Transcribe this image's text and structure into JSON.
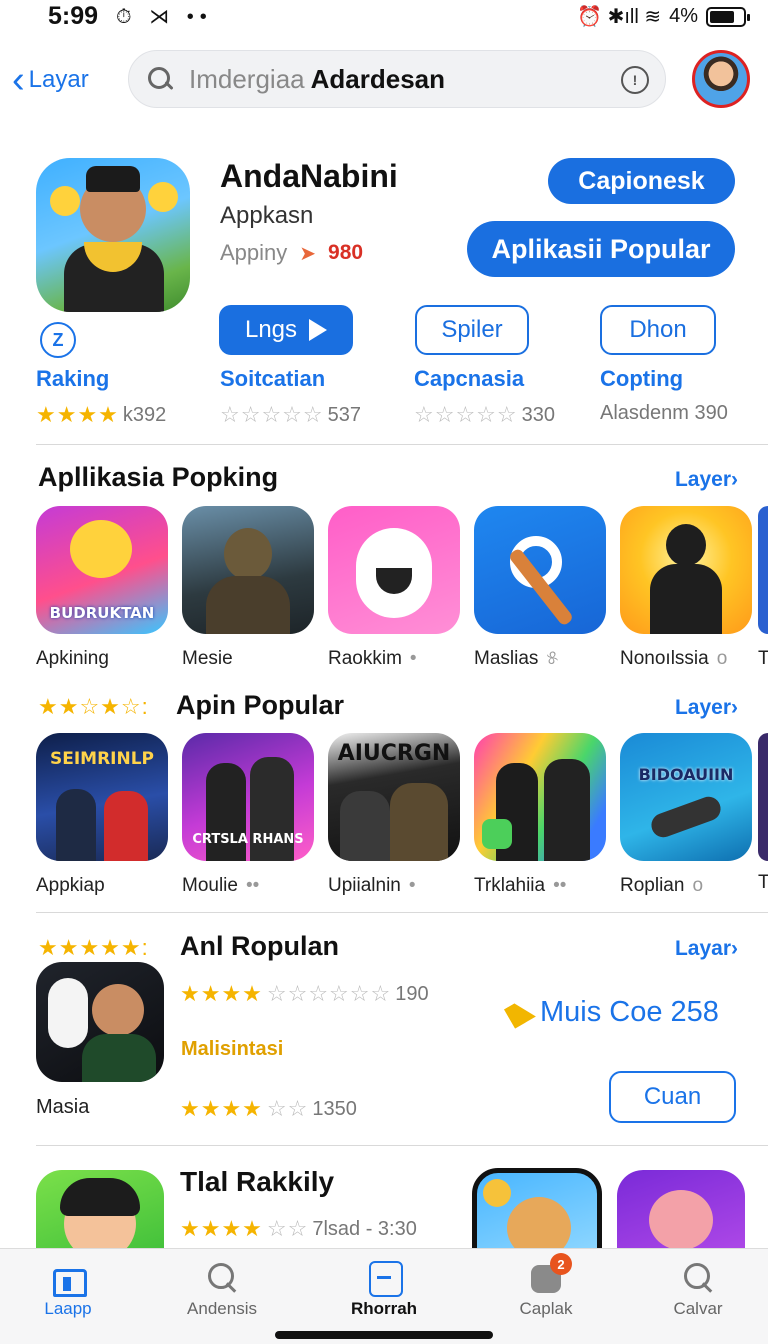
{
  "status": {
    "time": "5:99",
    "left_icons": "⏱ ⋊ ••",
    "right_icons": "⏰ ✱ıll ≋",
    "battery": "4%"
  },
  "header": {
    "back_label": "Layar",
    "search_placeholder": "Imdergiaa",
    "search_query": "Adardesan"
  },
  "featured": {
    "title": "AndaNabini",
    "subtitle": "Appkasn",
    "meta_label": "Appiny",
    "meta_value": "980",
    "button_primary": "Capionesk",
    "button_secondary": "Aplikasii Popular",
    "action_play": "Lngs",
    "action_two": "Spiler",
    "action_three": "Dhon",
    "stats": [
      {
        "label": "Raking",
        "rating": "k392"
      },
      {
        "label": "Soitcatian",
        "rating": "537"
      },
      {
        "label": "Capcnasia",
        "rating": "330"
      },
      {
        "label": "Copting",
        "rating": "Alasdenm 390"
      }
    ]
  },
  "section1": {
    "title": "Apllikasia Popking",
    "link": "Layer›",
    "apps": [
      {
        "name": "Apkining",
        "icon_text": "BUDRUKTAN"
      },
      {
        "name": "Mesie"
      },
      {
        "name": "Raokkim",
        "trail": "•"
      },
      {
        "name": "Maslias",
        "trail": "୫"
      },
      {
        "name": "Nonoılssia",
        "trail": "o"
      }
    ],
    "cut_label": "T"
  },
  "section2": {
    "title": "Apin Popular",
    "link": "Layer›",
    "apps": [
      {
        "name": "Appkiap",
        "icon_text": "SEIMRINLP"
      },
      {
        "name": "Moulie",
        "trail": "••",
        "icon_text": "CRTSLA RHANS"
      },
      {
        "name": "Upiialnin",
        "trail": "•",
        "icon_text": "AIUCRGN"
      },
      {
        "name": "Trklahiia",
        "trail": "••"
      },
      {
        "name": "Roplian",
        "trail": "o",
        "icon_text": "BIDOAUIIN"
      }
    ],
    "cut_label": "T"
  },
  "section3": {
    "title": "Anl Ropulan",
    "link": "Layar›",
    "app_name": "Masia",
    "rating1": "190",
    "subtitle": "Malisintasi",
    "rating2": "1350",
    "promo": "Muis Coe 258",
    "button": "Cuan"
  },
  "section4": {
    "title": "Tlal Rakkily",
    "rating": "7lsad - 3:30"
  },
  "tabs": [
    {
      "label": "Laapp",
      "icon": "home-icon"
    },
    {
      "label": "Andensis",
      "icon": "search-icon"
    },
    {
      "label": "Rhorrah",
      "icon": "square-icon"
    },
    {
      "label": "Caplak",
      "icon": "category-icon",
      "badge": "2"
    },
    {
      "label": "Calvar",
      "icon": "search-icon"
    }
  ],
  "colors": {
    "accent": "#1a6fe0",
    "star": "#f5b400",
    "badge": "#e8541e"
  }
}
